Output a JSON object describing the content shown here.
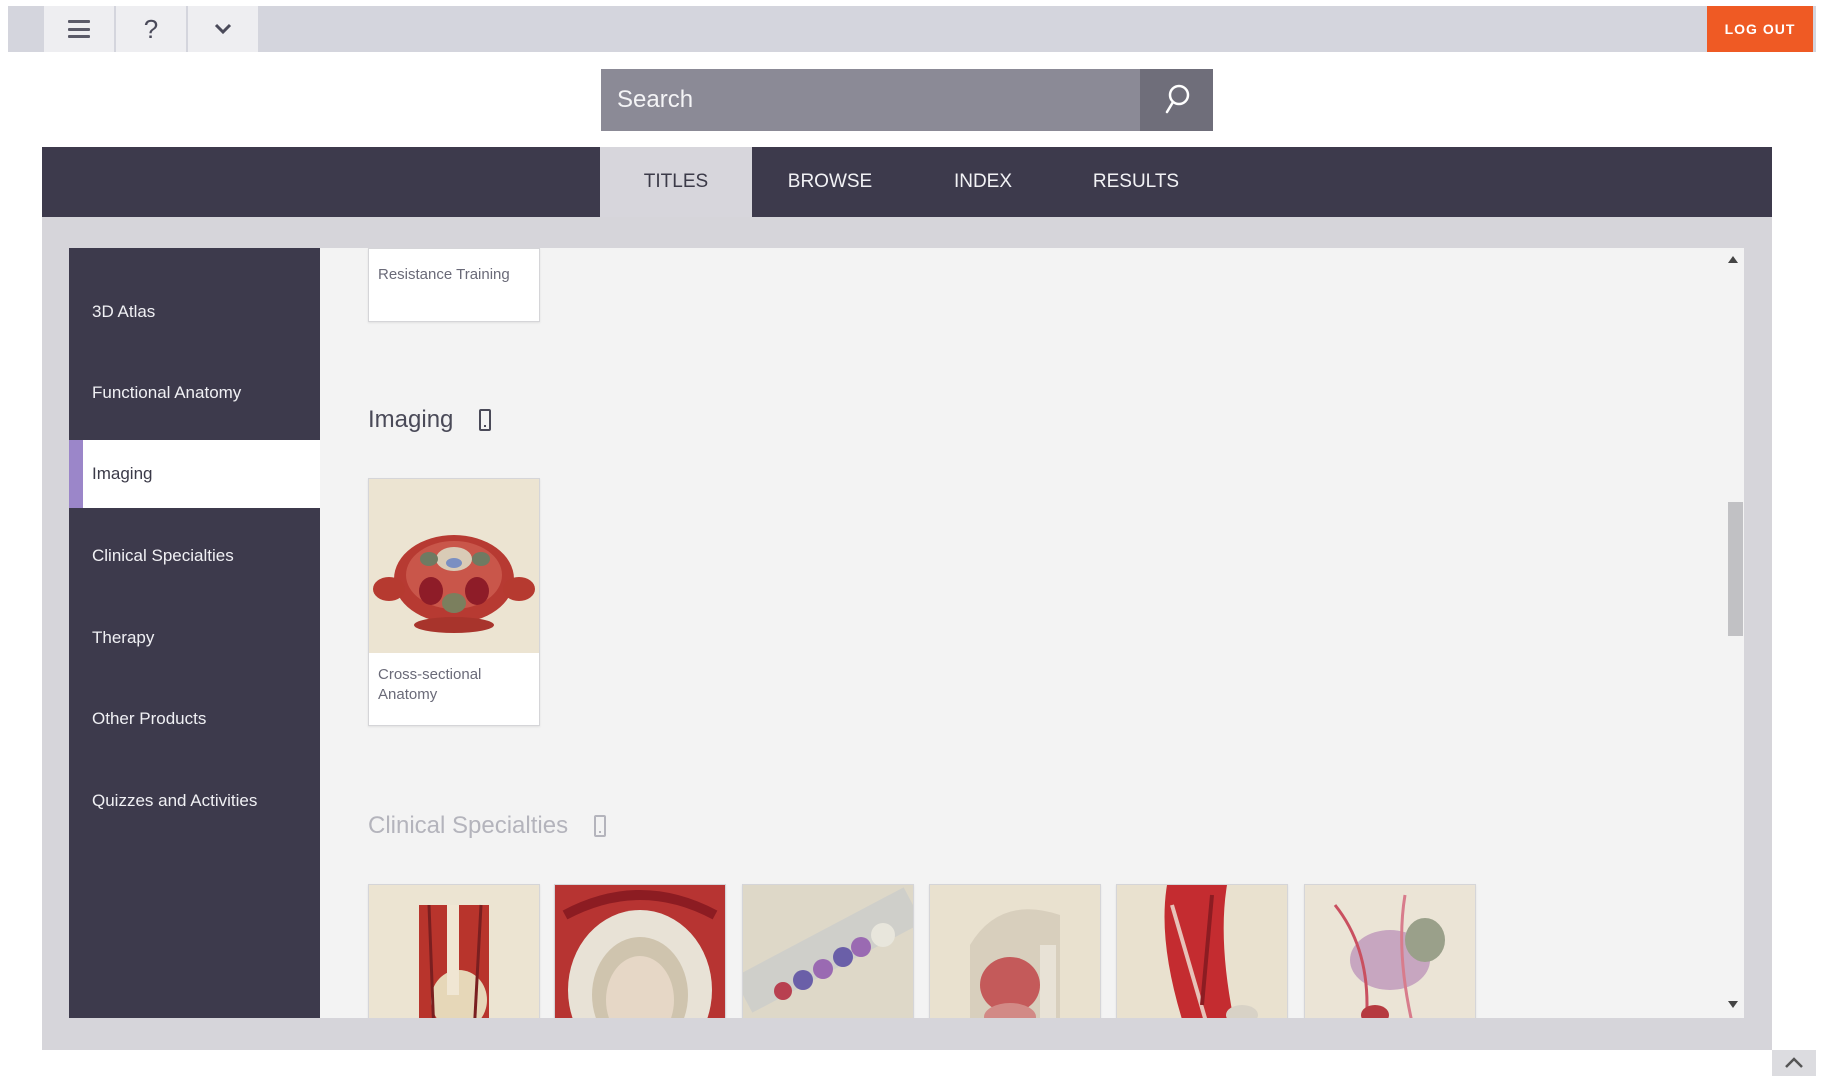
{
  "topbar": {
    "menu_icon": "hamburger-icon",
    "help_label": "?",
    "chevron_icon": "chevron-down-icon",
    "logout_label": "LOG OUT",
    "logout_color": "#ef5a24"
  },
  "search": {
    "placeholder": "Search",
    "icon": "search-icon"
  },
  "nav": {
    "tabs": [
      {
        "label": "TITLES",
        "active": true
      },
      {
        "label": "BROWSE",
        "active": false
      },
      {
        "label": "INDEX",
        "active": false
      },
      {
        "label": "RESULTS",
        "active": false
      }
    ]
  },
  "sidebar": {
    "items": [
      {
        "label": "3D Atlas",
        "active": false
      },
      {
        "label": "Functional Anatomy",
        "active": false
      },
      {
        "label": "Imaging",
        "active": true
      },
      {
        "label": "Clinical Specialties",
        "active": false
      },
      {
        "label": "Therapy",
        "active": false
      },
      {
        "label": "Other Products",
        "active": false
      },
      {
        "label": "Quizzes and Activities",
        "active": false
      }
    ],
    "active_accent": "#9b86c9"
  },
  "main": {
    "top_card_label": "Resistance Training",
    "sections": [
      {
        "title": "Imaging",
        "icon": "mobile-device-icon",
        "cards": [
          {
            "label_line1": "Cross-sectional",
            "label_line2": "Anatomy",
            "thumb": "cross-section-anatomy-thumbnail"
          }
        ]
      },
      {
        "title": "Clinical Specialties",
        "icon": "mobile-device-icon",
        "cards": [
          {
            "thumb": "shoulder-anatomy-thumbnail"
          },
          {
            "thumb": "dental-palate-thumbnail"
          },
          {
            "thumb": "dental-arch-thumbnail"
          },
          {
            "thumb": "head-neck-section-thumbnail"
          },
          {
            "thumb": "neck-muscles-thumbnail"
          },
          {
            "thumb": "pelvic-anatomy-thumbnail"
          }
        ]
      }
    ]
  },
  "scroll_to_top_icon": "chevron-up-icon"
}
